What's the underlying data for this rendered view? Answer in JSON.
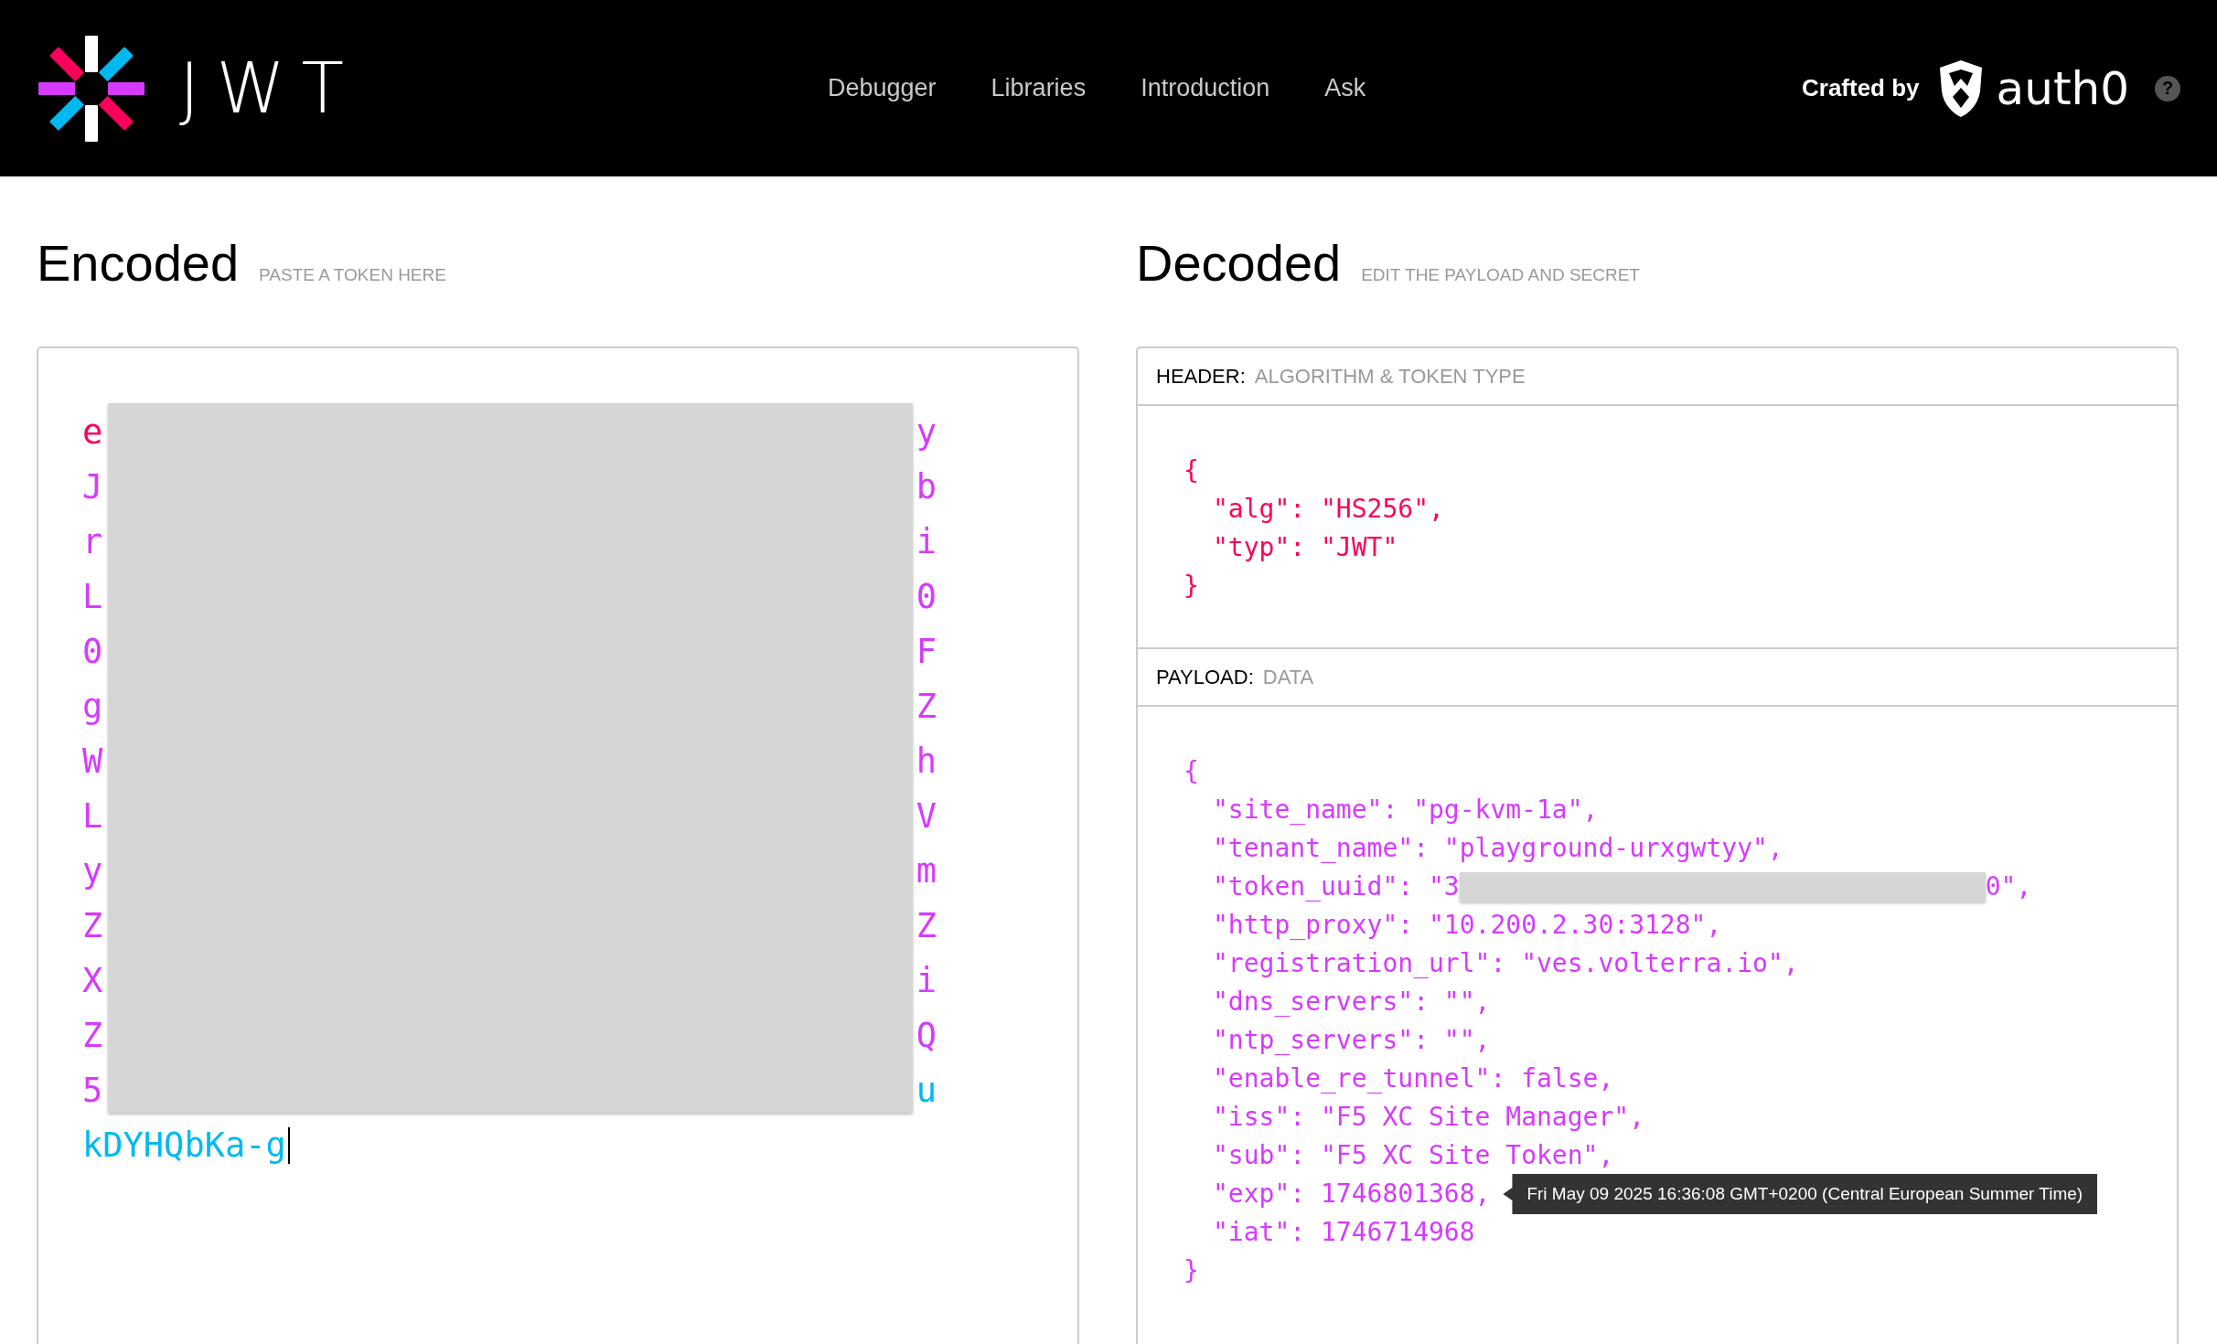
{
  "nav": {
    "logo_text": "JWT",
    "links": [
      "Debugger",
      "Libraries",
      "Introduction",
      "Ask"
    ],
    "crafted_by": "Crafted by",
    "brand": "auth0",
    "help": "?"
  },
  "encoded": {
    "title": "Encoded",
    "subtitle": "PASTE A TOKEN HERE",
    "lines": [
      {
        "start": {
          "text": "e",
          "color": "#fb015b"
        },
        "end": {
          "text": "y",
          "color": "#d63aff"
        }
      },
      {
        "start": {
          "text": "J",
          "color": "#d63aff"
        },
        "end": {
          "text": "b",
          "color": "#d63aff"
        }
      },
      {
        "start": {
          "text": "r",
          "color": "#d63aff"
        },
        "end": {
          "text": "i",
          "color": "#d63aff"
        }
      },
      {
        "start": {
          "text": "L",
          "color": "#d63aff"
        },
        "end": {
          "text": "0",
          "color": "#d63aff"
        }
      },
      {
        "start": {
          "text": "0",
          "color": "#d63aff"
        },
        "end": {
          "text": "F",
          "color": "#d63aff"
        }
      },
      {
        "start": {
          "text": "g",
          "color": "#d63aff"
        },
        "end": {
          "text": "Z",
          "color": "#d63aff"
        }
      },
      {
        "start": {
          "text": "W",
          "color": "#d63aff"
        },
        "end": {
          "text": "h",
          "color": "#d63aff"
        }
      },
      {
        "start": {
          "text": "L",
          "color": "#d63aff"
        },
        "end": {
          "text": "V",
          "color": "#d63aff"
        }
      },
      {
        "start": {
          "text": "y",
          "color": "#d63aff"
        },
        "end": {
          "text": "m",
          "color": "#d63aff"
        }
      },
      {
        "start": {
          "text": "Z",
          "color": "#d63aff"
        },
        "end": {
          "text": "Z",
          "color": "#d63aff"
        }
      },
      {
        "start": {
          "text": "X",
          "color": "#d63aff"
        },
        "end": {
          "text": "i",
          "color": "#d63aff"
        }
      },
      {
        "start": {
          "text": "Z",
          "color": "#d63aff"
        },
        "end": {
          "text": "Q",
          "color": "#d63aff"
        }
      },
      {
        "start": {
          "text": "5",
          "color": "#d63aff"
        },
        "end": {
          "text": "u",
          "color": "#00b9f1"
        }
      }
    ],
    "last_line": {
      "text": "kDYHQbKa-g",
      "color": "#00b9f1"
    }
  },
  "decoded": {
    "title": "Decoded",
    "subtitle": "EDIT THE PAYLOAD AND SECRET",
    "sections": [
      {
        "label": "HEADER:",
        "sublabel": "ALGORITHM & TOKEN TYPE",
        "color": "#fb015b",
        "lines": [
          {
            "kind": "brace",
            "text": "{"
          },
          {
            "kind": "property",
            "text": "\"alg\": \"HS256\","
          },
          {
            "kind": "property",
            "text": "\"typ\": \"JWT\""
          },
          {
            "kind": "brace",
            "text": "}"
          }
        ]
      },
      {
        "label": "PAYLOAD:",
        "sublabel": "DATA",
        "color": "#d63aff",
        "lines": [
          {
            "kind": "brace",
            "text": "{"
          },
          {
            "kind": "property",
            "text": "\"site_name\": \"pg-kvm-1a\","
          },
          {
            "kind": "property",
            "text": "\"tenant_name\": \"playground-urxgwtyy\","
          },
          {
            "kind": "redacted",
            "before": "\"token_uuid\": \"3",
            "after": "0\","
          },
          {
            "kind": "property",
            "text": "\"http_proxy\": \"10.200.2.30:3128\","
          },
          {
            "kind": "property",
            "text": "\"registration_url\": \"ves.volterra.io\","
          },
          {
            "kind": "property",
            "text": "\"dns_servers\": \"\","
          },
          {
            "kind": "property",
            "text": "\"ntp_servers\": \"\","
          },
          {
            "kind": "property",
            "text": "\"enable_re_tunnel\": false,"
          },
          {
            "kind": "property",
            "text": "\"iss\": \"F5 XC Site Manager\","
          },
          {
            "kind": "property",
            "text": "\"sub\": \"F5 XC Site Token\","
          },
          {
            "kind": "property",
            "text": "\"exp\": 1746801368,",
            "tooltip": "Fri May 09 2025 16:36:08 GMT+0200 (Central European Summer Time)"
          },
          {
            "kind": "property",
            "text": "\"iat\": 1746714968"
          },
          {
            "kind": "brace",
            "text": "}"
          }
        ]
      }
    ]
  }
}
